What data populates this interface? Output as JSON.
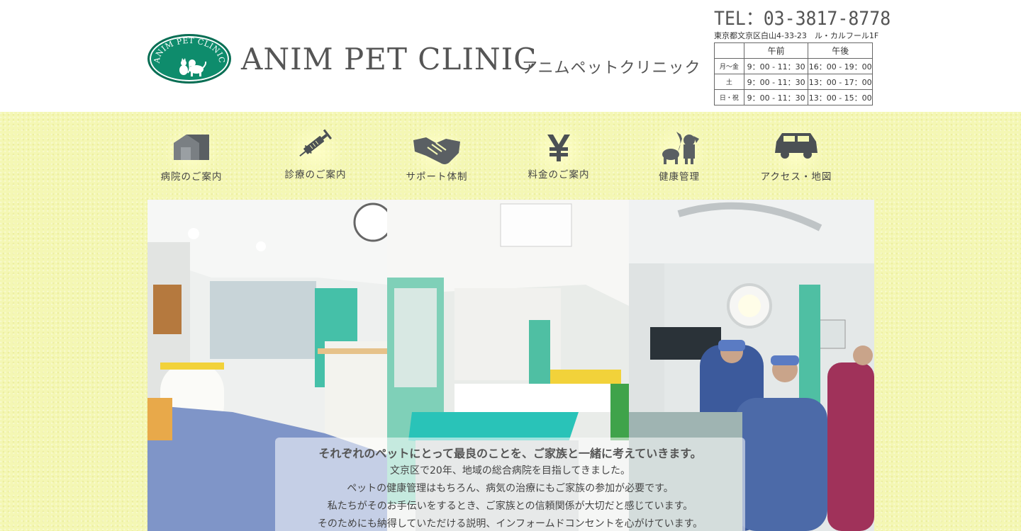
{
  "header": {
    "logo_text": "ANIM PET CLINIC",
    "title": "ANIM PET CLINIC",
    "title_kana": "アニムペットクリニック",
    "tel": "TEL：03-3817-8778",
    "address": "東京都文京区白山4-33-23　ル・カルフール1F"
  },
  "hours": {
    "col_am": "午前",
    "col_pm": "午後",
    "rows": [
      {
        "day": "月～金",
        "am": "9：00 - 11：30",
        "pm": "16：00 - 19：00"
      },
      {
        "day": "土",
        "am": "9：00 - 11：30",
        "pm": "13：00 - 17：00"
      },
      {
        "day": "日・祝",
        "am": "9：00 - 11：30",
        "pm": "13：00 - 15：00"
      }
    ]
  },
  "nav": [
    {
      "label": "病院のご案内",
      "icon": "house-icon"
    },
    {
      "label": "診療のご案内",
      "icon": "syringe-icon"
    },
    {
      "label": "サポート体制",
      "icon": "handshake-icon"
    },
    {
      "label": "料金のご案内",
      "icon": "yen-icon"
    },
    {
      "label": "健康管理",
      "icon": "pets-icon"
    },
    {
      "label": "アクセス・地図",
      "icon": "car-icon"
    }
  ],
  "hero": {
    "lead": "それぞれのペットにとって最良のことを、ご家族と一緒に考えていきます。",
    "lines": [
      "文京区で20年、地域の総合病院を目指してきました。",
      "ペットの健康管理はもちろん、病気の治療にもご家族の参加が必要です。",
      "私たちがそのお手伝いをするとき、ご家族との信頼関係が大切だと感じています。",
      "そのためにも納得していただける説明、インフォームドコンセントを心がけています。"
    ]
  },
  "colors": {
    "brand_green": "#0e8c6c",
    "background_yellow": "#f4f7b4",
    "icon_gray": "#5a5f63"
  }
}
